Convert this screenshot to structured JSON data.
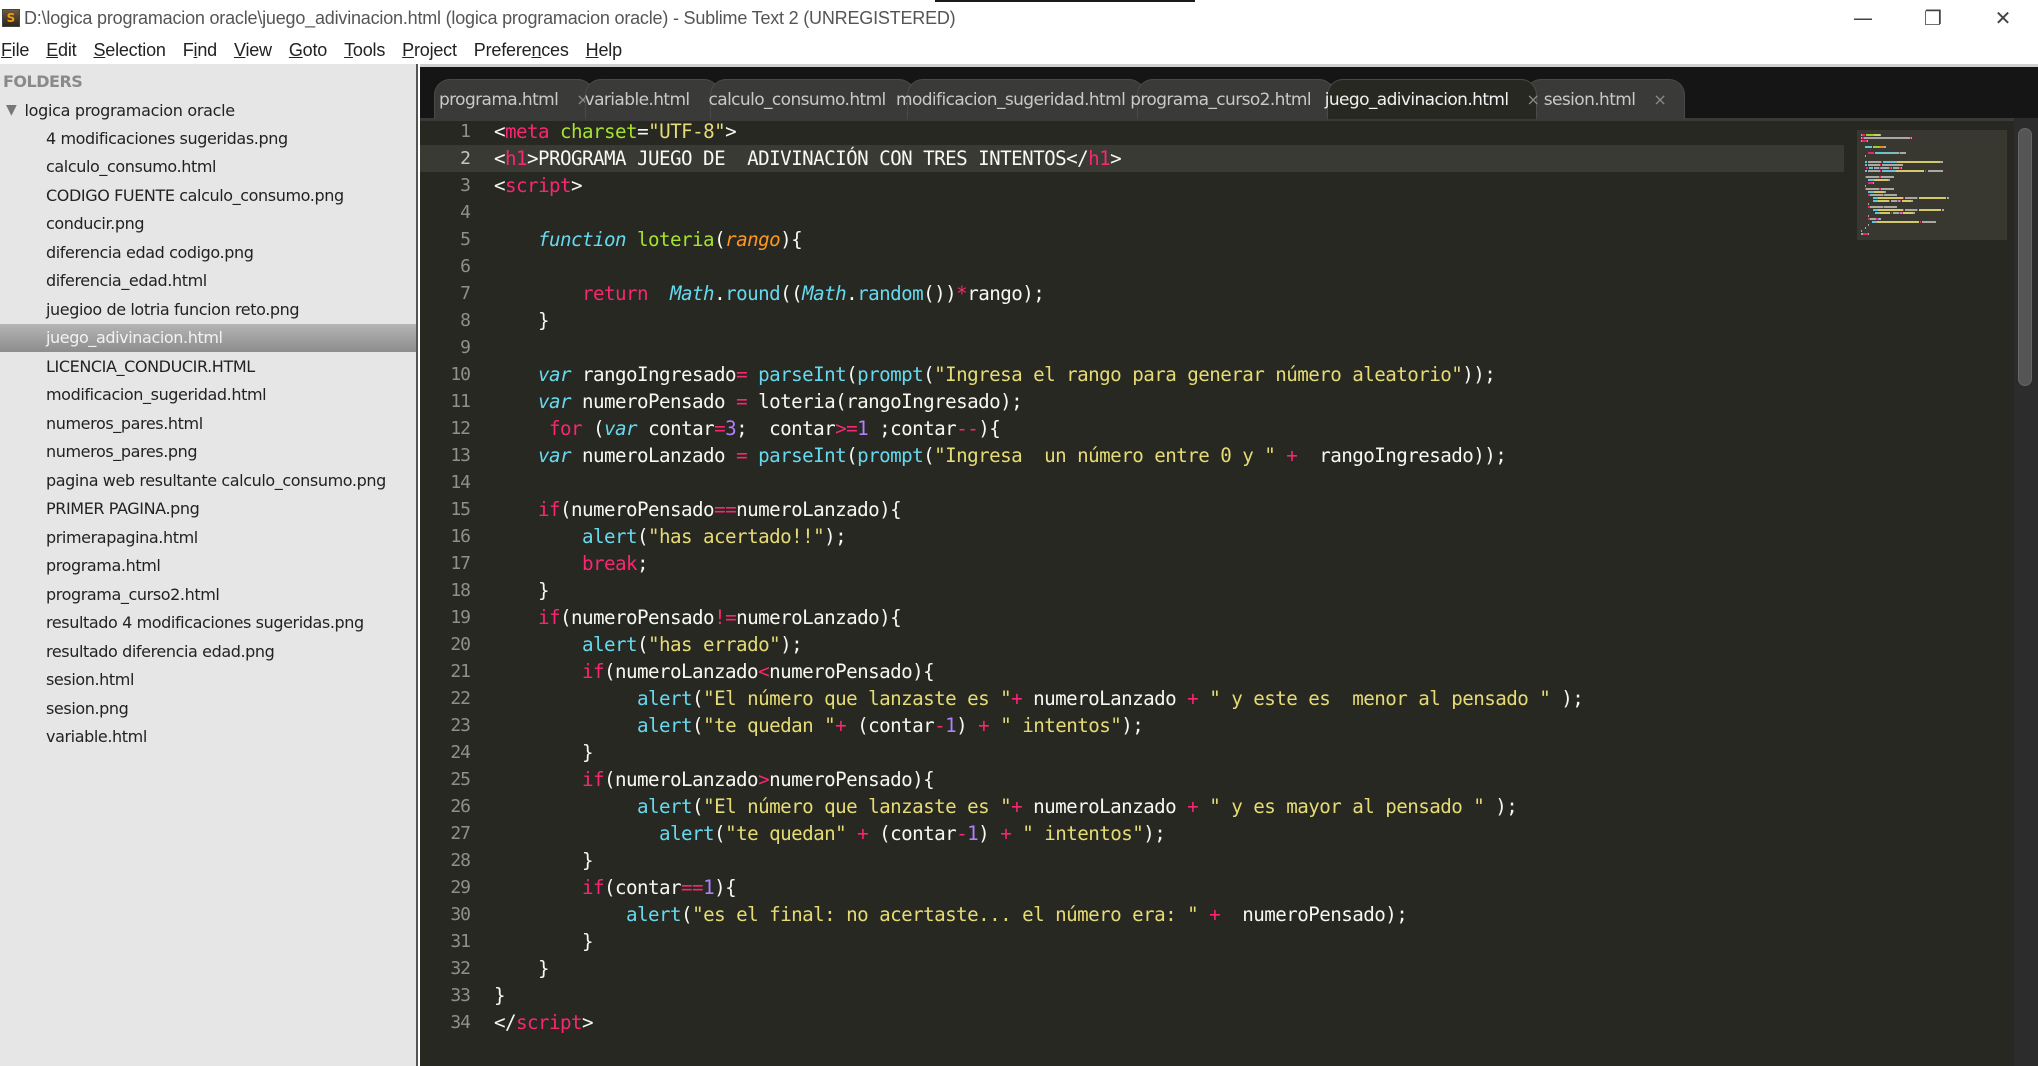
{
  "window": {
    "title": "D:\\logica programacion oracle\\juego_adivinacion.html (logica programacion oracle) - Sublime Text 2 (UNREGISTERED)",
    "app_icon": "sublime-text-icon",
    "controls": {
      "minimize": "—",
      "restore": "❐",
      "close": "✕"
    }
  },
  "menu": [
    {
      "label": "File",
      "ul": "F",
      "rest": "ile"
    },
    {
      "label": "Edit",
      "ul": "E",
      "rest": "dit"
    },
    {
      "label": "Selection",
      "ul": "S",
      "rest": "election"
    },
    {
      "label": "Find",
      "pre": "F",
      "ul": "i",
      "rest": "nd"
    },
    {
      "label": "View",
      "ul": "V",
      "rest": "iew"
    },
    {
      "label": "Goto",
      "ul": "G",
      "rest": "oto"
    },
    {
      "label": "Tools",
      "ul": "T",
      "rest": "ools"
    },
    {
      "label": "Project",
      "ul": "P",
      "rest": "roject"
    },
    {
      "label": "Preferences",
      "pre": "Prefere",
      "ul": "n",
      "rest": "ces"
    },
    {
      "label": "Help",
      "ul": "H",
      "rest": "elp"
    }
  ],
  "sidebar": {
    "header": "FOLDERS",
    "folder": {
      "name": "logica programacion oracle",
      "expanded": true,
      "toggle_glyph": "▼"
    },
    "files": [
      "4 modificaciones sugeridas.png",
      "calculo_consumo.html",
      "CODIGO FUENTE calculo_consumo.png",
      "conducir.png",
      "diferencia edad codigo.png",
      "diferencia_edad.html",
      "juegioo de lotria funcion reto.png",
      "juego_adivinacion.html",
      "LICENCIA_CONDUCIR.HTML",
      "modificacion_sugeridad.html",
      "numeros_pares.html",
      "numeros_pares.png",
      "pagina web resultante  calculo_consumo.png",
      "PRIMER PAGINA.png",
      "primerapagina.html",
      "programa.html",
      "programa_curso2.html",
      "resultado 4 modificaciones sugeridas.png",
      "resultado diferencia edad.png",
      "sesion.html",
      "sesion.png",
      "variable.html"
    ],
    "selected_file": "juego_adivinacion.html"
  },
  "tabs": [
    {
      "label": "programa.html",
      "close": "×"
    },
    {
      "label": "variable.html",
      "close": "×"
    },
    {
      "label": "calculo_consumo.html",
      "close": "×"
    },
    {
      "label": "modificacion_sugeridad.html",
      "close": "×"
    },
    {
      "label": "programa_curso2.html",
      "close": "×"
    },
    {
      "label": "juego_adivinacion.html",
      "close": "×",
      "active": true
    },
    {
      "label": "sesion.html",
      "close": "×"
    }
  ],
  "editor": {
    "highlighted_line": 2,
    "theme_colors": {
      "background": "#272822",
      "keyword": "#f92672",
      "string": "#e6db74",
      "function": "#a6e22e",
      "storage": "#66d9ef",
      "parameter": "#fd971f",
      "number": "#ae81ff",
      "text": "#f8f8f2"
    },
    "lines": [
      [
        [
          "p",
          "<"
        ],
        [
          "tag",
          "meta"
        ],
        [
          "p",
          " "
        ],
        [
          "attr",
          "charset"
        ],
        [
          "p",
          "="
        ],
        [
          "str",
          "\"UTF-8\""
        ],
        [
          "p",
          ">"
        ]
      ],
      [
        [
          "p",
          "<"
        ],
        [
          "tag",
          "h1"
        ],
        [
          "p",
          ">PROGRAMA JUEGO DE  ADIVINACIÓN CON TRES INTENTOS</"
        ],
        [
          "tag",
          "h1"
        ],
        [
          "p",
          ">"
        ]
      ],
      [
        [
          "p",
          "<"
        ],
        [
          "tag",
          "script"
        ],
        [
          "p",
          ">"
        ]
      ],
      [],
      [
        [
          "p",
          "    "
        ],
        [
          "sto",
          "function"
        ],
        [
          "p",
          " "
        ],
        [
          "fn",
          "loteria"
        ],
        [
          "p",
          "("
        ],
        [
          "param",
          "rango"
        ],
        [
          "p",
          "){"
        ]
      ],
      [],
      [
        [
          "p",
          "        "
        ],
        [
          "kw",
          "return"
        ],
        [
          "p",
          "  "
        ],
        [
          "cls",
          "Math"
        ],
        [
          "p",
          "."
        ],
        [
          "sup",
          "round"
        ],
        [
          "p",
          "(("
        ],
        [
          "cls",
          "Math"
        ],
        [
          "p",
          "."
        ],
        [
          "sup",
          "random"
        ],
        [
          "p",
          "())"
        ],
        [
          "op",
          "*"
        ],
        [
          "p",
          "rango);"
        ]
      ],
      [
        [
          "p",
          "    }"
        ]
      ],
      [],
      [
        [
          "p",
          "    "
        ],
        [
          "sto",
          "var"
        ],
        [
          "p",
          " rangoIngresado"
        ],
        [
          "op",
          "="
        ],
        [
          "p",
          " "
        ],
        [
          "sup",
          "parseInt"
        ],
        [
          "p",
          "("
        ],
        [
          "sup",
          "prompt"
        ],
        [
          "p",
          "("
        ],
        [
          "str",
          "\"Ingresa el rango para generar número aleatorio\""
        ],
        [
          "p",
          "));"
        ]
      ],
      [
        [
          "p",
          "    "
        ],
        [
          "sto",
          "var"
        ],
        [
          "p",
          " numeroPensado "
        ],
        [
          "op",
          "="
        ],
        [
          "p",
          " loteria(rangoIngresado);"
        ]
      ],
      [
        [
          "p",
          "     "
        ],
        [
          "kw",
          "for"
        ],
        [
          "p",
          " ("
        ],
        [
          "sto",
          "var"
        ],
        [
          "p",
          " contar"
        ],
        [
          "op",
          "="
        ],
        [
          "num",
          "3"
        ],
        [
          "p",
          ";  contar"
        ],
        [
          "op",
          ">="
        ],
        [
          "num",
          "1"
        ],
        [
          "p",
          " ;contar"
        ],
        [
          "op",
          "--"
        ],
        [
          "p",
          "){"
        ]
      ],
      [
        [
          "p",
          "    "
        ],
        [
          "sto",
          "var"
        ],
        [
          "p",
          " numeroLanzado "
        ],
        [
          "op",
          "="
        ],
        [
          "p",
          " "
        ],
        [
          "sup",
          "parseInt"
        ],
        [
          "p",
          "("
        ],
        [
          "sup",
          "prompt"
        ],
        [
          "p",
          "("
        ],
        [
          "str",
          "\"Ingresa  un número entre 0 y \""
        ],
        [
          "p",
          " "
        ],
        [
          "op",
          "+"
        ],
        [
          "p",
          "  rangoIngresado));"
        ]
      ],
      [],
      [
        [
          "p",
          "    "
        ],
        [
          "kw",
          "if"
        ],
        [
          "p",
          "(numeroPensado"
        ],
        [
          "op",
          "=="
        ],
        [
          "p",
          "numeroLanzado){"
        ]
      ],
      [
        [
          "p",
          "        "
        ],
        [
          "sup",
          "alert"
        ],
        [
          "p",
          "("
        ],
        [
          "str",
          "\"has acertado!!\""
        ],
        [
          "p",
          ");"
        ]
      ],
      [
        [
          "p",
          "        "
        ],
        [
          "kw",
          "break"
        ],
        [
          "p",
          ";"
        ]
      ],
      [
        [
          "p",
          "    }"
        ]
      ],
      [
        [
          "p",
          "    "
        ],
        [
          "kw",
          "if"
        ],
        [
          "p",
          "(numeroPensado"
        ],
        [
          "op",
          "!="
        ],
        [
          "p",
          "numeroLanzado){"
        ]
      ],
      [
        [
          "p",
          "        "
        ],
        [
          "sup",
          "alert"
        ],
        [
          "p",
          "("
        ],
        [
          "str",
          "\"has errado\""
        ],
        [
          "p",
          ");"
        ]
      ],
      [
        [
          "p",
          "        "
        ],
        [
          "kw",
          "if"
        ],
        [
          "p",
          "(numeroLanzado"
        ],
        [
          "op",
          "<"
        ],
        [
          "p",
          "numeroPensado){"
        ]
      ],
      [
        [
          "p",
          "             "
        ],
        [
          "sup",
          "alert"
        ],
        [
          "p",
          "("
        ],
        [
          "str",
          "\"El número que lanzaste es \""
        ],
        [
          "op",
          "+"
        ],
        [
          "p",
          " numeroLanzado "
        ],
        [
          "op",
          "+"
        ],
        [
          "p",
          " "
        ],
        [
          "str",
          "\" y este es  menor al pensado \""
        ],
        [
          "p",
          " );"
        ]
      ],
      [
        [
          "p",
          "             "
        ],
        [
          "sup",
          "alert"
        ],
        [
          "p",
          "("
        ],
        [
          "str",
          "\"te quedan \""
        ],
        [
          "op",
          "+"
        ],
        [
          "p",
          " (contar"
        ],
        [
          "op",
          "-"
        ],
        [
          "num",
          "1"
        ],
        [
          "p",
          ") "
        ],
        [
          "op",
          "+"
        ],
        [
          "p",
          " "
        ],
        [
          "str",
          "\" intentos\""
        ],
        [
          "p",
          ");"
        ]
      ],
      [
        [
          "p",
          "        }"
        ]
      ],
      [
        [
          "p",
          "        "
        ],
        [
          "kw",
          "if"
        ],
        [
          "p",
          "(numeroLanzado"
        ],
        [
          "op",
          ">"
        ],
        [
          "p",
          "numeroPensado){"
        ]
      ],
      [
        [
          "p",
          "             "
        ],
        [
          "sup",
          "alert"
        ],
        [
          "p",
          "("
        ],
        [
          "str",
          "\"El número que lanzaste es \""
        ],
        [
          "op",
          "+"
        ],
        [
          "p",
          " numeroLanzado "
        ],
        [
          "op",
          "+"
        ],
        [
          "p",
          " "
        ],
        [
          "str",
          "\" y es mayor al pensado \""
        ],
        [
          "p",
          " );"
        ]
      ],
      [
        [
          "p",
          "               "
        ],
        [
          "sup",
          "alert"
        ],
        [
          "p",
          "("
        ],
        [
          "str",
          "\"te quedan\""
        ],
        [
          "p",
          " "
        ],
        [
          "op",
          "+"
        ],
        [
          "p",
          " (contar"
        ],
        [
          "op",
          "-"
        ],
        [
          "num",
          "1"
        ],
        [
          "p",
          ") "
        ],
        [
          "op",
          "+"
        ],
        [
          "p",
          " "
        ],
        [
          "str",
          "\" intentos\""
        ],
        [
          "p",
          ");"
        ]
      ],
      [
        [
          "p",
          "        }"
        ]
      ],
      [
        [
          "p",
          "        "
        ],
        [
          "kw",
          "if"
        ],
        [
          "p",
          "(contar"
        ],
        [
          "op",
          "=="
        ],
        [
          "num",
          "1"
        ],
        [
          "p",
          "){"
        ]
      ],
      [
        [
          "p",
          "            "
        ],
        [
          "sup",
          "alert"
        ],
        [
          "p",
          "("
        ],
        [
          "str",
          "\"es el final: no acertaste... el número era: \""
        ],
        [
          "p",
          " "
        ],
        [
          "op",
          "+"
        ],
        [
          "p",
          "  numeroPensado);"
        ]
      ],
      [
        [
          "p",
          "        }"
        ]
      ],
      [
        [
          "p",
          "    }"
        ]
      ],
      [
        [
          "p",
          "}"
        ]
      ],
      [
        [
          "p",
          "</"
        ],
        [
          "tag",
          "script"
        ],
        [
          "p",
          ">"
        ]
      ]
    ]
  }
}
